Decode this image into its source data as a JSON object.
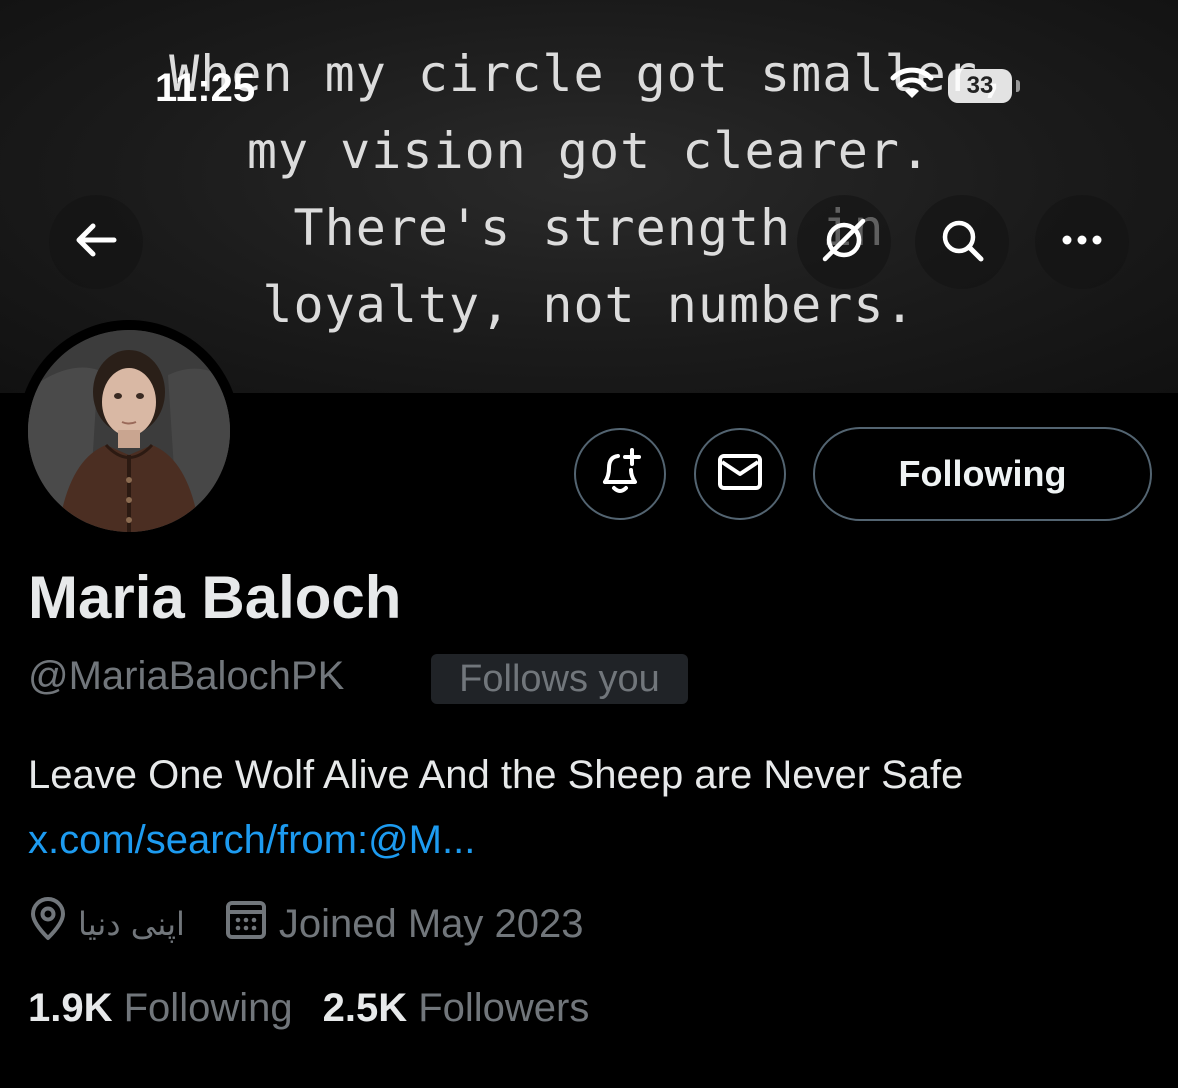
{
  "status_bar": {
    "time": "11:25",
    "battery": "33"
  },
  "banner": {
    "quote_lines": [
      "When my circle got smaller,",
      "my vision got clearer.",
      "There's strength in",
      "loyalty, not numbers."
    ]
  },
  "nav": {
    "back_icon": "arrow-left-icon",
    "grok_icon": "grok-icon",
    "search_icon": "search-icon",
    "more_icon": "more-icon"
  },
  "profile": {
    "name": "Maria Baloch",
    "handle": "@MariaBalochPK",
    "follows_you": "Follows you",
    "bio": "Leave One Wolf Alive And the Sheep are Never Safe",
    "link": "x.com/search/from:@M...",
    "location": "اپنی دنیا",
    "joined": "Joined May 2023",
    "following_count": "1.9K",
    "following_label": "Following",
    "followers_count": "2.5K",
    "followers_label": "Followers"
  },
  "actions": {
    "notify_icon": "bell-plus-icon",
    "message_icon": "envelope-icon",
    "following_button": "Following"
  },
  "colors": {
    "background": "#000000",
    "text": "#e7e9ea",
    "muted": "#71767b",
    "link": "#1d9bf0",
    "border": "#536471"
  }
}
